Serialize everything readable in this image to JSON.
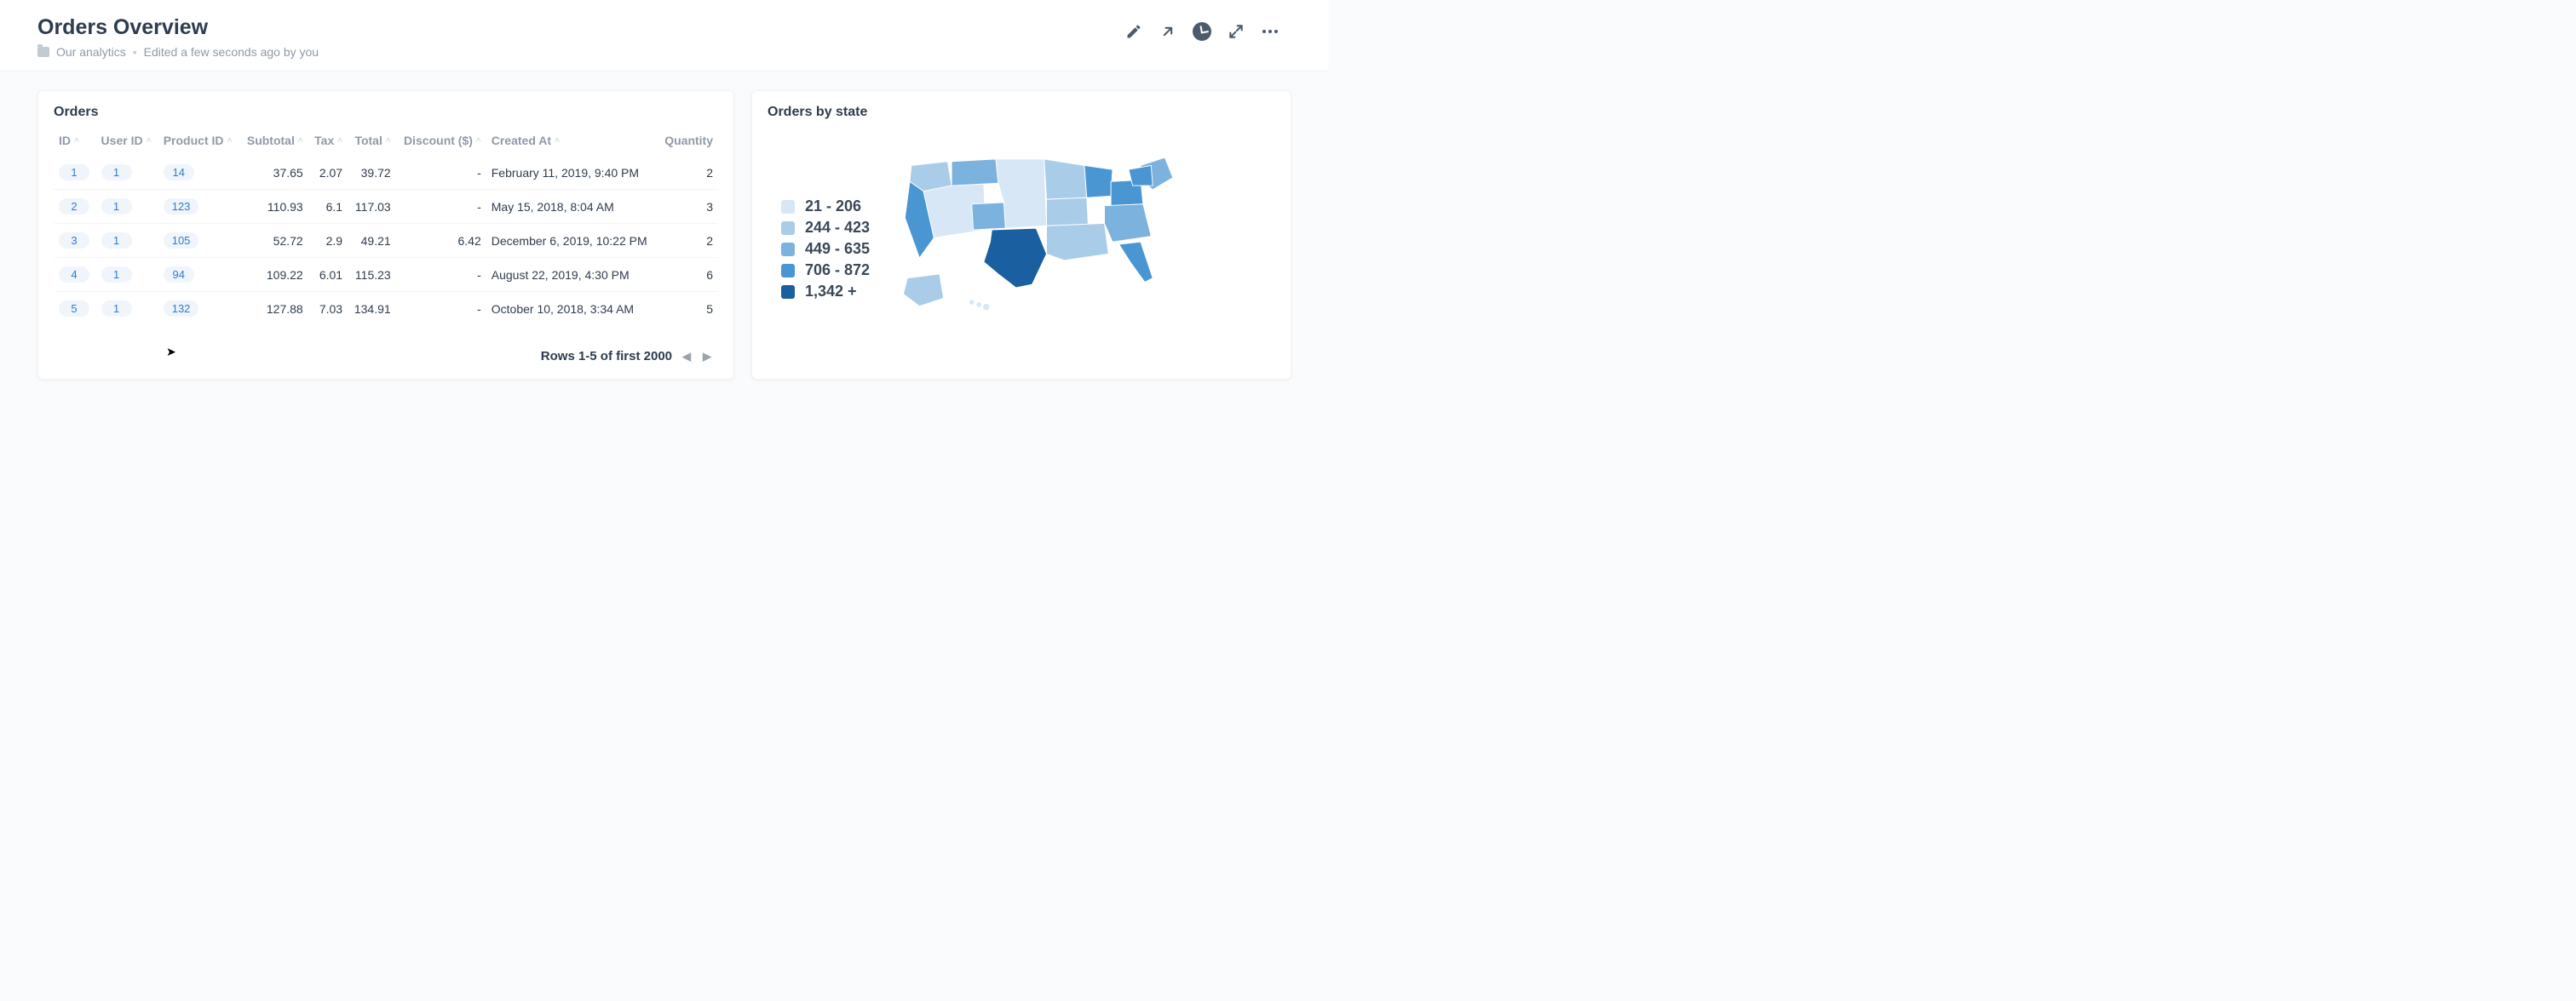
{
  "header": {
    "title": "Orders Overview",
    "folder": "Our analytics",
    "edited": "Edited a few seconds ago by you"
  },
  "orders_card": {
    "title": "Orders",
    "columns": {
      "id": "ID",
      "user_id": "User ID",
      "product_id": "Product ID",
      "subtotal": "Subtotal",
      "tax": "Tax",
      "total": "Total",
      "discount": "Discount ($)",
      "created_at": "Created At",
      "quantity": "Quantity"
    },
    "rows": [
      {
        "id": "1",
        "user_id": "1",
        "product_id": "14",
        "subtotal": "37.65",
        "tax": "2.07",
        "total": "39.72",
        "discount": "-",
        "created_at": "February 11, 2019, 9:40 PM",
        "quantity": "2"
      },
      {
        "id": "2",
        "user_id": "1",
        "product_id": "123",
        "subtotal": "110.93",
        "tax": "6.1",
        "total": "117.03",
        "discount": "-",
        "created_at": "May 15, 2018, 8:04 AM",
        "quantity": "3"
      },
      {
        "id": "3",
        "user_id": "1",
        "product_id": "105",
        "subtotal": "52.72",
        "tax": "2.9",
        "total": "49.21",
        "discount": "6.42",
        "created_at": "December 6, 2019, 10:22 PM",
        "quantity": "2"
      },
      {
        "id": "4",
        "user_id": "1",
        "product_id": "94",
        "subtotal": "109.22",
        "tax": "6.01",
        "total": "115.23",
        "discount": "-",
        "created_at": "August 22, 2019, 4:30 PM",
        "quantity": "6"
      },
      {
        "id": "5",
        "user_id": "1",
        "product_id": "132",
        "subtotal": "127.88",
        "tax": "7.03",
        "total": "134.91",
        "discount": "-",
        "created_at": "October 10, 2018, 3:34 AM",
        "quantity": "5"
      }
    ],
    "pager": "Rows 1-5 of first 2000"
  },
  "map_card": {
    "title": "Orders by state",
    "legend": [
      {
        "color": "#d7e7f5",
        "label": "21 - 206"
      },
      {
        "color": "#a9cce9",
        "label": "244 - 423"
      },
      {
        "color": "#7bb2de",
        "label": "449 - 635"
      },
      {
        "color": "#4a96d2",
        "label": "706 - 872"
      },
      {
        "color": "#1a5fa0",
        "label": "1,342 +"
      }
    ]
  },
  "chart_data": {
    "type": "choropleth",
    "title": "Orders by state",
    "region": "United States",
    "bins": [
      {
        "min": 21,
        "max": 206,
        "color": "#d7e7f5"
      },
      {
        "min": 244,
        "max": 423,
        "color": "#a9cce9"
      },
      {
        "min": 449,
        "max": 635,
        "color": "#7bb2de"
      },
      {
        "min": 706,
        "max": 872,
        "color": "#4a96d2"
      },
      {
        "min": 1342,
        "max": null,
        "color": "#1a5fa0"
      }
    ],
    "note": "Per-state counts shown by shade; Texas is in the highest bin (1,342+); California, New York, Florida, Pennsylvania, Ohio, Illinois, Michigan appear in the 706-872 bin; most western/plains states are in lower bins."
  }
}
